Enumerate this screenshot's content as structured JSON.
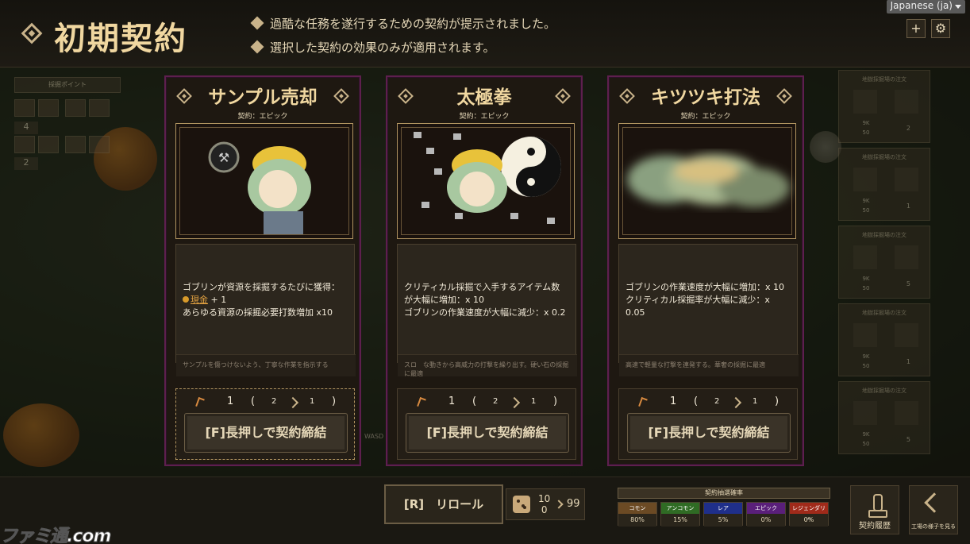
{
  "header": {
    "title": "初期契約",
    "notes": [
      "過酷な任務を遂行するための契約が提示されました。",
      "選択した契約の効果のみが適用されます。"
    ],
    "language": "Japanese (ja)",
    "add_icon": "plus-icon",
    "settings_icon": "gear-icon"
  },
  "left_panel": {
    "title": "採掘ポイント",
    "counts": [
      "4",
      "2"
    ]
  },
  "right_panel": {
    "cards": [
      {
        "title": "地獄採掘場の注文",
        "amount": "9K",
        "sub": "50",
        "reward": "2"
      },
      {
        "title": "地獄採掘場の注文",
        "amount": "9K",
        "sub": "50",
        "reward": "1"
      },
      {
        "title": "地獄採掘場の注文",
        "amount": "9K",
        "sub": "50",
        "reward": "5"
      },
      {
        "title": "地獄採掘場の注文",
        "amount": "9K",
        "sub": "50",
        "reward": "1"
      },
      {
        "title": "地獄採掘場の注文",
        "amount": "9K",
        "sub": "50",
        "reward": "5"
      }
    ]
  },
  "cards": [
    {
      "title": "サンプル売却",
      "rarity": "契約：エピック",
      "desc_line1": "ゴブリンが資源を採掘するたびに獲得：",
      "cash_label": "現金",
      "cash_amount": " + 1",
      "desc_line3": "あらゆる資源の採掘必要打数増加 x10",
      "flavor": "サンプルを傷つけないよう、丁寧な作業を指示する",
      "count_main": "1",
      "count_from": "2",
      "count_to": "1",
      "button": "[F]長押しで契約締結"
    },
    {
      "title": "太極拳",
      "rarity": "契約：エピック",
      "desc": "クリティカル採掘で入手するアイテム数\nが大幅に増加：x 10\nゴブリンの作業速度が大幅に減少：x 0.2",
      "flavor": "スロ　な動きから高威力の打撃を繰り出す。硬い石の採掘に最適",
      "count_main": "1",
      "count_from": "2",
      "count_to": "1",
      "button": "[F]長押しで契約締結"
    },
    {
      "title": "キツツキ打法",
      "rarity": "契約：エピック",
      "desc": "ゴブリンの作業速度が大幅に増加：x 10\nクリティカル採掘率が大幅に減少：x\n0.05",
      "flavor": "高速で軽量な打撃を連発する。華奢の採掘に最適",
      "count_main": "1",
      "count_from": "2",
      "count_to": "1",
      "button": "[F]長押しで契約締結"
    }
  ],
  "bottom": {
    "reroll": "[R]　リロール",
    "dice_top": "10",
    "dice_bottom": "0",
    "dice_total": "99",
    "prob_title": "契約抽選確率",
    "probs": [
      {
        "label": "コモン",
        "value": "80%",
        "color": "#6b4a24"
      },
      {
        "label": "アンコモン",
        "value": "15%",
        "color": "#2f6b24"
      },
      {
        "label": "レア",
        "value": "5%",
        "color": "#1f2f8a"
      },
      {
        "label": "エピック",
        "value": "0%",
        "color": "#5a1f7a"
      },
      {
        "label": "レジェンダリー",
        "value": "0%",
        "color": "#a02a1a"
      }
    ],
    "history_button": "契約履歴",
    "workshop_button": "工場の様子を見る",
    "wasd_hint": "WASD"
  },
  "watermark": "ファミ通.com"
}
